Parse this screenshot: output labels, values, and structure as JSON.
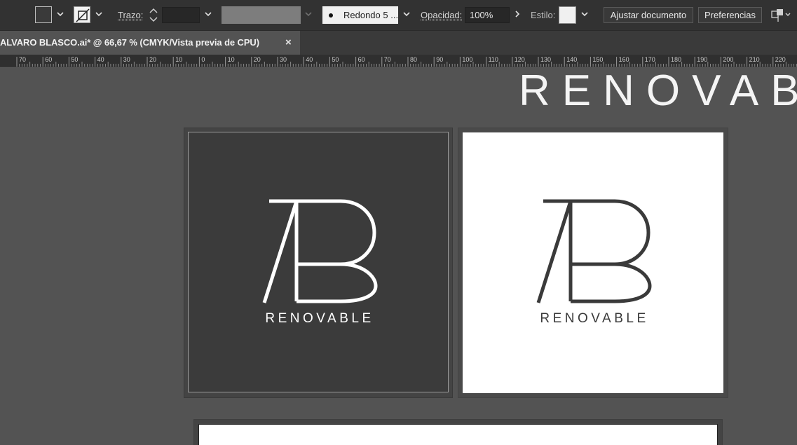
{
  "control_bar": {
    "fill_color": "#3a3a3a",
    "stroke_color": "#f2f2f2",
    "stroke_label": "Trazo:",
    "stroke_weight": "",
    "brush_label": "Redondo 5 ...",
    "opacity_label": "Opacidad:",
    "opacity_value": "100%",
    "style_label": "Estilo:",
    "adjust_document_button": "Ajustar documento",
    "preferences_button": "Preferencias"
  },
  "document_tab": {
    "title": "ALVARO BLASCO.ai* @ 66,67 % (CMYK/Vista previa de CPU)",
    "close_glyph": "×"
  },
  "ruler": {
    "labels": [
      "70",
      "60",
      "50",
      "40",
      "30",
      "20",
      "10",
      "0",
      "10",
      "20",
      "30",
      "40",
      "50",
      "60",
      "70",
      "80",
      "90",
      "100",
      "110",
      "120",
      "130",
      "140",
      "150",
      "160",
      "170",
      "180",
      "190",
      "200",
      "210",
      "220"
    ]
  },
  "canvas": {
    "headline": "RENOVABLE",
    "artboards": [
      {
        "background": "#3b3b3b",
        "logo_color": "#ffffff",
        "monogram": "AB",
        "wordmark": "RENOVABLE"
      },
      {
        "background": "#ffffff",
        "logo_color": "#3a3a3a",
        "monogram": "AB",
        "wordmark": "RENOVABLE"
      }
    ]
  }
}
